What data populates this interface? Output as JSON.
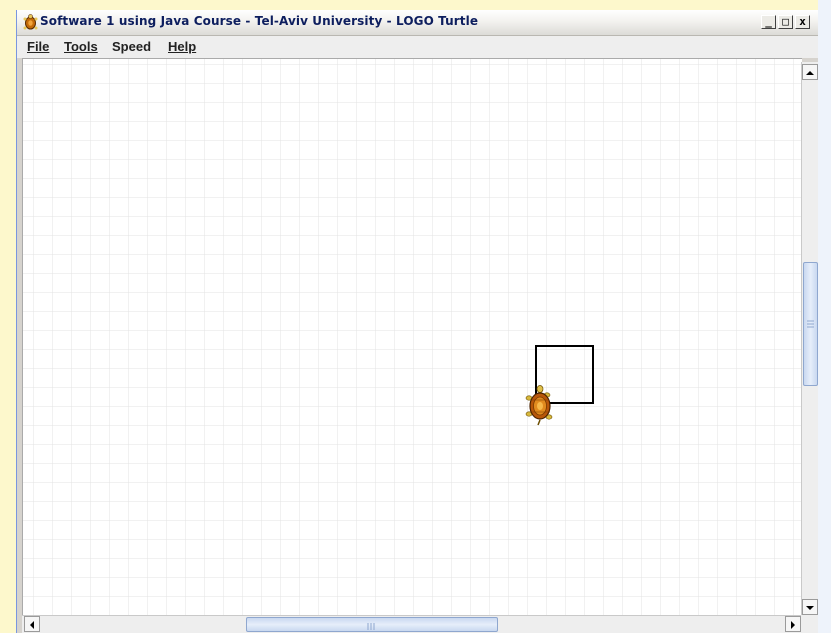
{
  "window": {
    "title": "Software 1 using Java Course - Tel-Aviv University - LOGO Turtle",
    "minimize_glyph": "_",
    "maximize_glyph": "□",
    "close_glyph": "x",
    "icon": "turtle-app-icon"
  },
  "menu": {
    "items": [
      {
        "label": "File"
      },
      {
        "label": "Tools"
      },
      {
        "label": "Speed"
      },
      {
        "label": "Help"
      }
    ]
  },
  "canvas": {
    "background": "#ffffff",
    "grid_color": "#e3e3e3",
    "drawing": "square outline drawn by turtle",
    "turtle_icon": "turtle-icon"
  },
  "scrollbars": {
    "vertical": {
      "position_fraction": 0.46,
      "visible_fraction": 0.25
    },
    "horizontal": {
      "position_fraction": 0.29,
      "visible_fraction": 0.33
    }
  },
  "colors": {
    "title_text": "#0d1e5e",
    "menubar": "#eeeeee",
    "scroll_thumb": "#c9d8f0",
    "stroke": "#000000"
  }
}
